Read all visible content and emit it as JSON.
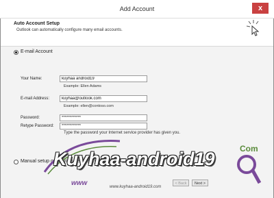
{
  "window": {
    "title": "Add Account",
    "close_label": "x"
  },
  "header": {
    "title": "Auto Account Setup",
    "subtitle": "Outlook can automatically configure many email accounts."
  },
  "options": {
    "email_account": "E-mail Account",
    "manual_setup": "Manual setup or additional server types"
  },
  "form": {
    "name_label": "Your Name:",
    "name_value": "kuyhaa android19",
    "name_example": "Example: Ellen Adams",
    "email_label": "E-mail Address:",
    "email_value": "kuyhaa@outlook.com",
    "email_example": "Example: ellen@contoso.com",
    "password_label": "Password:",
    "password_value": "************",
    "retype_label": "Retype Password:",
    "retype_value": "************",
    "password_hint": "Type the password your Internet service provider has given you."
  },
  "buttons": {
    "back": "< Back",
    "next": "Next >"
  },
  "watermark": {
    "main": "Kuyhaa-android19",
    "com": "Com",
    "www": "www",
    "url": "www.kuyhaa-android19.com"
  },
  "colors": {
    "close": "#c94141",
    "watermark_green": "#5a8b3b",
    "watermark_purple": "#7a4a9a"
  }
}
